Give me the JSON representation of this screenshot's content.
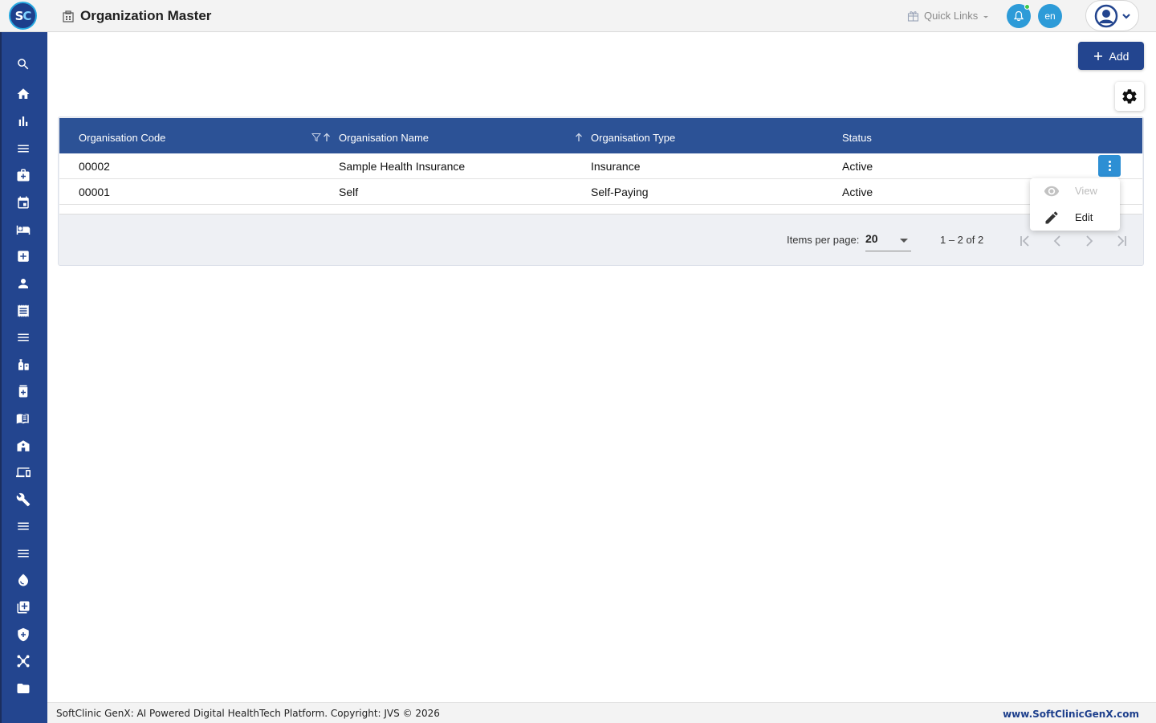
{
  "app": {
    "logo_text_1": "S",
    "logo_text_2": "C",
    "page_title": "Organization Master",
    "quick_links_label": "Quick Links",
    "language": "en"
  },
  "sidebar": {
    "items": [
      {
        "icon": "search-icon"
      },
      {
        "icon": "home-icon"
      },
      {
        "icon": "bar-chart-icon"
      },
      {
        "icon": "menu-lines-icon"
      },
      {
        "icon": "medical-bag-icon"
      },
      {
        "icon": "calendar-icon"
      },
      {
        "icon": "bed-icon"
      },
      {
        "icon": "medical-plus-icon"
      },
      {
        "icon": "person-icon"
      },
      {
        "icon": "receipt-icon"
      },
      {
        "icon": "menu-lines-icon"
      },
      {
        "icon": "medication-icon"
      },
      {
        "icon": "pharmacy-icon"
      },
      {
        "icon": "book-icon"
      },
      {
        "icon": "building-icon"
      },
      {
        "icon": "devices-icon"
      },
      {
        "icon": "wrench-icon"
      },
      {
        "icon": "menu-lines-icon"
      },
      {
        "icon": "menu-lines-icon"
      },
      {
        "icon": "blood-drop-icon"
      },
      {
        "icon": "add-library-icon"
      },
      {
        "icon": "shield-plus-icon"
      },
      {
        "icon": "network-icon"
      },
      {
        "icon": "folder-icon"
      }
    ]
  },
  "toolbar": {
    "add_label": "Add"
  },
  "table": {
    "columns": [
      "Organisation Code",
      "Organisation Name",
      "Organisation Type",
      "Status"
    ],
    "rows": [
      [
        "00002",
        "Sample Health Insurance",
        "Insurance",
        "Active"
      ],
      [
        "00001",
        "Self",
        "Self-Paying",
        "Active"
      ]
    ]
  },
  "row_menu": {
    "view_label": "View",
    "edit_label": "Edit"
  },
  "paginator": {
    "items_per_page_label": "Items per page:",
    "page_size": "20",
    "range": "1 – 2 of 2"
  },
  "footer": {
    "copyright": "SoftClinic GenX: AI Powered Digital HealthTech Platform. Copyright: JVS © 2026",
    "website": "www.SoftClinicGenX.com"
  },
  "colors": {
    "brand_blue": "#23458f",
    "header_blue": "#2c5296",
    "accent_blue": "#2d9bd8"
  }
}
